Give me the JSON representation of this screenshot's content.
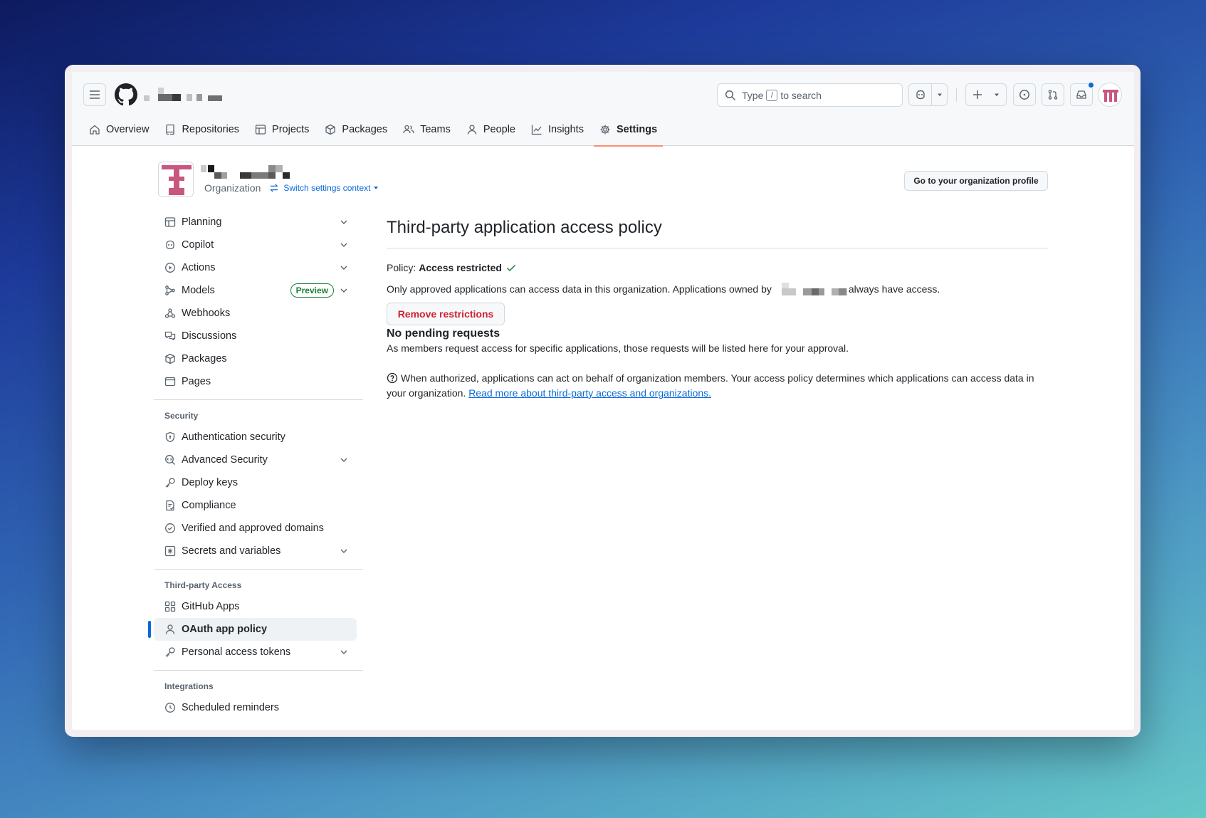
{
  "header": {
    "search_prefix": "Type",
    "search_key": "/",
    "search_suffix": "to search",
    "tabs": [
      {
        "label": "Overview",
        "icon": "home-icon"
      },
      {
        "label": "Repositories",
        "icon": "repo-icon"
      },
      {
        "label": "Projects",
        "icon": "table-icon"
      },
      {
        "label": "Packages",
        "icon": "package-icon"
      },
      {
        "label": "Teams",
        "icon": "people-icon"
      },
      {
        "label": "People",
        "icon": "person-icon"
      },
      {
        "label": "Insights",
        "icon": "graph-icon"
      },
      {
        "label": "Settings",
        "icon": "gear-icon",
        "active": true
      }
    ]
  },
  "org": {
    "type_label": "Organization",
    "switch_label": "Switch settings context",
    "profile_button": "Go to your organization profile"
  },
  "sidebar": {
    "group1": [
      {
        "label": "Planning",
        "expandable": true
      },
      {
        "label": "Copilot",
        "expandable": true
      },
      {
        "label": "Actions",
        "expandable": true
      },
      {
        "label": "Models",
        "badge": "Preview",
        "expandable": true
      },
      {
        "label": "Webhooks"
      },
      {
        "label": "Discussions"
      },
      {
        "label": "Packages"
      },
      {
        "label": "Pages"
      }
    ],
    "security_heading": "Security",
    "security": [
      {
        "label": "Authentication security"
      },
      {
        "label": "Advanced Security",
        "expandable": true
      },
      {
        "label": "Deploy keys"
      },
      {
        "label": "Compliance"
      },
      {
        "label": "Verified and approved domains"
      },
      {
        "label": "Secrets and variables",
        "expandable": true
      }
    ],
    "third_party_heading": "Third-party Access",
    "third_party": [
      {
        "label": "GitHub Apps"
      },
      {
        "label": "OAuth app policy",
        "active": true
      },
      {
        "label": "Personal access tokens",
        "expandable": true
      }
    ],
    "integrations_heading": "Integrations",
    "integrations": [
      {
        "label": "Scheduled reminders"
      }
    ]
  },
  "main": {
    "title": "Third-party application access policy",
    "policy_label": "Policy:",
    "policy_value": "Access restricted",
    "description_before": "Only approved applications can access data in this organization. Applications owned by",
    "description_after": "always have access.",
    "remove_button": "Remove restrictions",
    "pending_title": "No pending requests",
    "pending_desc": "As members request access for specific applications, those requests will be listed here for your approval.",
    "info_text": "When authorized, applications can act on behalf of organization members. Your access policy determines which applications can access data in your organization.",
    "info_link": "Read more about third-party access and organizations."
  },
  "colors": {
    "accent": "#0969da",
    "danger": "#cf222e",
    "success": "#1a7f37",
    "tab_underline": "#fd8c73",
    "org_avatar": "#c8577f"
  }
}
